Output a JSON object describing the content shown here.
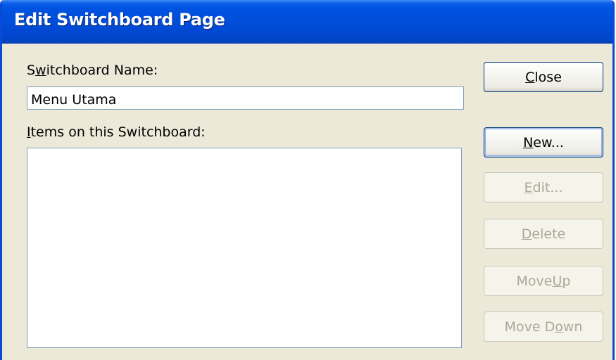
{
  "window": {
    "title": "Edit Switchboard Page"
  },
  "form": {
    "name_label": "Switchboard Name:",
    "name_value": "Menu Utama",
    "items_label": "Items on this Switchboard:",
    "items": []
  },
  "buttons": {
    "close": "Close",
    "new": "New...",
    "edit": "Edit...",
    "delete": "Delete",
    "move_up": "Move Up",
    "move_down": "Move Down"
  },
  "colors": {
    "titlebar": "#0054e3",
    "dialog_bg": "#ece9d8",
    "disabled_text": "#aca899"
  }
}
